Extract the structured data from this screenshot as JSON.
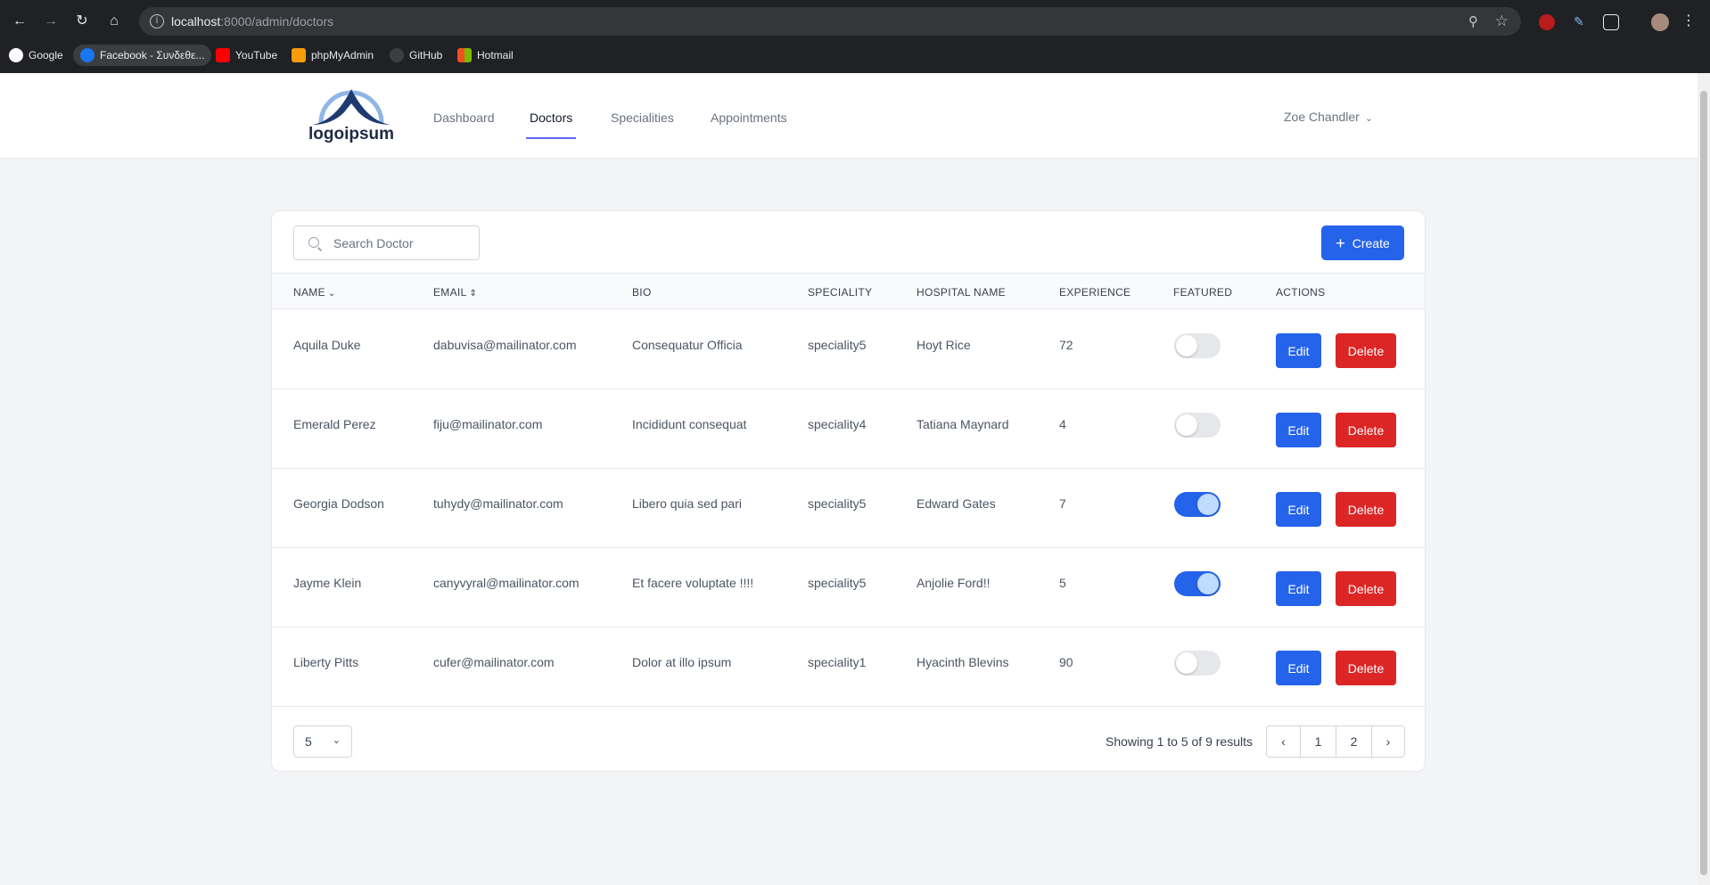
{
  "browser": {
    "url_host": "localhost",
    "url_rest": ":8000/admin/doctors",
    "bookmarks": [
      "Google",
      "Facebook - Συνδεθε...",
      "YouTube",
      "phpMyAdmin",
      "GitHub",
      "Hotmail"
    ]
  },
  "nav": {
    "logo_text": "logoipsum",
    "links": [
      "Dashboard",
      "Doctors",
      "Specialities",
      "Appointments"
    ],
    "active": "Doctors",
    "user": "Zoe Chandler"
  },
  "toolbar": {
    "search_placeholder": "Search Doctor",
    "create_label": "Create"
  },
  "table": {
    "headers": [
      "NAME",
      "EMAIL",
      "BIO",
      "SPECIALITY",
      "HOSPITAL NAME",
      "EXPERIENCE",
      "FEATURED",
      "ACTIONS"
    ],
    "rows": [
      {
        "name": "Aquila Duke",
        "email": "dabuvisa@mailinator.com",
        "bio": "Consequatur Officia",
        "speciality": "speciality5",
        "hospital": "Hoyt Rice",
        "experience": "72",
        "featured": false
      },
      {
        "name": "Emerald Perez",
        "email": "fiju@mailinator.com",
        "bio": "Incididunt consequat",
        "speciality": "speciality4",
        "hospital": "Tatiana Maynard",
        "experience": "4",
        "featured": false
      },
      {
        "name": "Georgia Dodson",
        "email": "tuhydy@mailinator.com",
        "bio": "Libero quia sed pari",
        "speciality": "speciality5",
        "hospital": "Edward Gates",
        "experience": "7",
        "featured": true
      },
      {
        "name": "Jayme Klein",
        "email": "canyvyral@mailinator.com",
        "bio": "Et facere voluptate !!!!",
        "speciality": "speciality5",
        "hospital": "Anjolie Ford!!",
        "experience": "5",
        "featured": true
      },
      {
        "name": "Liberty Pitts",
        "email": "cufer@mailinator.com",
        "bio": "Dolor at illo ipsum",
        "speciality": "speciality1",
        "hospital": "Hyacinth Blevins",
        "experience": "90",
        "featured": false
      }
    ],
    "edit_label": "Edit",
    "delete_label": "Delete"
  },
  "pagination": {
    "per_page": "5",
    "summary": "Showing 1 to 5 of 9 results",
    "pages": [
      "1",
      "2"
    ]
  }
}
